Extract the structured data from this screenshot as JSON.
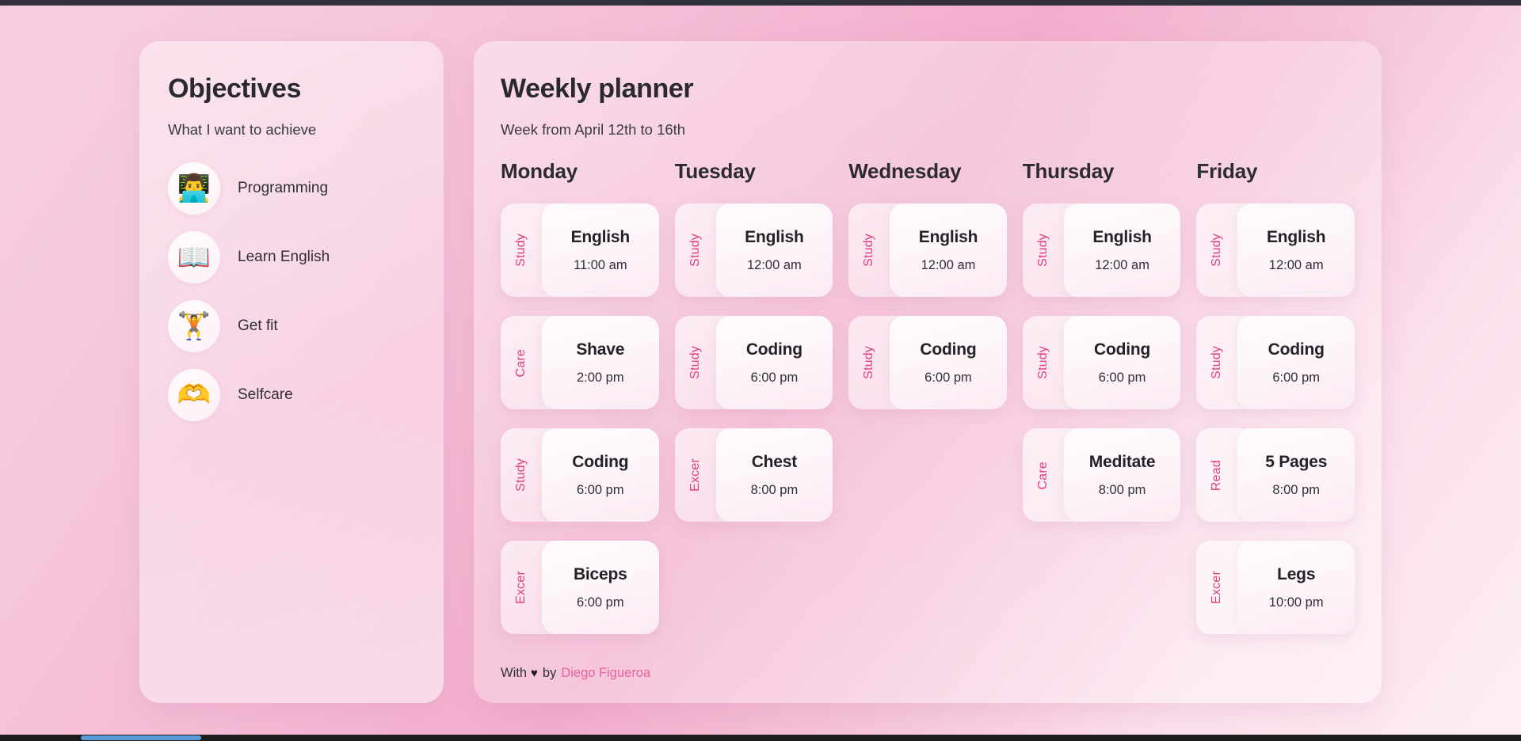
{
  "theme": {
    "accent_pink": "#e0407f",
    "author_link": "#e8639c",
    "bg_gradient_from": "#f9cfe0",
    "bg_gradient_to": "#fdeef4",
    "text_dark": "#2a2a2e"
  },
  "objectives": {
    "title": "Objectives",
    "subtitle": "What I want to achieve",
    "items": [
      {
        "label": "Programming",
        "icon": "technologist-icon",
        "glyph": "👨‍💻"
      },
      {
        "label": "Learn English",
        "icon": "open-book-icon",
        "glyph": "📖"
      },
      {
        "label": "Get fit",
        "icon": "weightlifter-icon",
        "glyph": "🏋️"
      },
      {
        "label": "Selfcare",
        "icon": "heart-hands-icon",
        "glyph": "🫶"
      }
    ]
  },
  "planner": {
    "title": "Weekly planner",
    "subtitle": "Week from April 12th to 16th",
    "days": [
      {
        "name": "Monday",
        "tasks": [
          {
            "category": "Study",
            "title": "English",
            "time": "11:00 am"
          },
          {
            "category": "Care",
            "title": "Shave",
            "time": "2:00 pm"
          },
          {
            "category": "Study",
            "title": "Coding",
            "time": "6:00 pm"
          },
          {
            "category": "Excer",
            "title": "Biceps",
            "time": "6:00 pm"
          }
        ]
      },
      {
        "name": "Tuesday",
        "tasks": [
          {
            "category": "Study",
            "title": "English",
            "time": "12:00 am"
          },
          {
            "category": "Study",
            "title": "Coding",
            "time": "6:00 pm"
          },
          {
            "category": "Excer",
            "title": "Chest",
            "time": "8:00 pm"
          }
        ]
      },
      {
        "name": "Wednesday",
        "tasks": [
          {
            "category": "Study",
            "title": "English",
            "time": "12:00 am"
          },
          {
            "category": "Study",
            "title": "Coding",
            "time": "6:00 pm"
          }
        ]
      },
      {
        "name": "Thursday",
        "tasks": [
          {
            "category": "Study",
            "title": "English",
            "time": "12:00 am"
          },
          {
            "category": "Study",
            "title": "Coding",
            "time": "6:00 pm"
          },
          {
            "category": "Care",
            "title": "Meditate",
            "time": "8:00 pm"
          }
        ]
      },
      {
        "name": "Friday",
        "tasks": [
          {
            "category": "Study",
            "title": "English",
            "time": "12:00 am"
          },
          {
            "category": "Study",
            "title": "Coding",
            "time": "6:00 pm"
          },
          {
            "category": "Read",
            "title": "5 Pages",
            "time": "8:00 pm"
          },
          {
            "category": "Excer",
            "title": "Legs",
            "time": "10:00 pm"
          }
        ]
      }
    ],
    "footer": {
      "prefix": "With",
      "heart": "♥",
      "by": "by",
      "author": "Diego Figueroa"
    }
  }
}
